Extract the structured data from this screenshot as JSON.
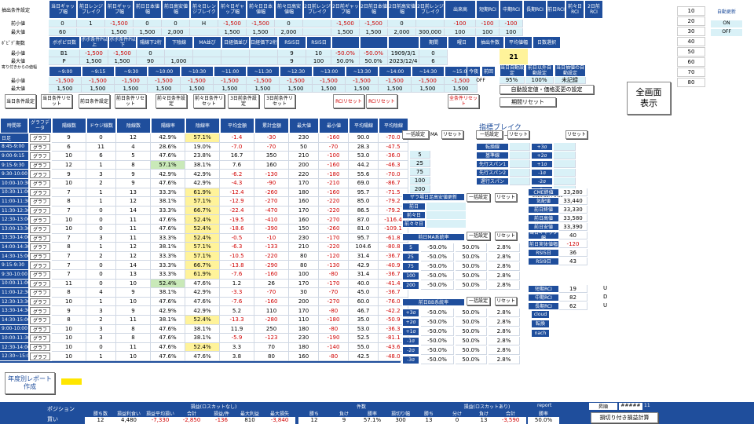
{
  "top": {
    "row_labels": [
      "抽出条件設定",
      "前小値",
      "最大値",
      "ﾎﾟﾋﾟﾃﾞ期数",
      "最小値",
      "最大値",
      "寄り付きからの値幅",
      "最小値",
      "最大値"
    ],
    "headers1": [
      "当日ギャップ幅",
      "前日レンジブレイク",
      "前日ギャップ幅",
      "前日日本値幅",
      "前日高安値幅",
      "前々日レンジブレイク",
      "前々日ギャップ幅",
      "前々日日本値幅",
      "前々日高安値幅",
      "2日前レンジブレイク",
      "2日前ギャップ幅",
      "2日前日本値幅",
      "2日前高安値幅",
      "2日前レンジブレイク",
      "出来高",
      "短期RCI",
      "中期RCI",
      "長期RCI",
      "前日RCI",
      "前々日RCI",
      "2日前RCI"
    ],
    "min1": [
      "0",
      "1",
      "-1,500",
      "0",
      "0",
      "H",
      "-1,500",
      "-1,500",
      "0",
      "",
      "-1,500",
      "-1,500",
      "0",
      "",
      "-100",
      "-100",
      "-100"
    ],
    "max1": [
      "60",
      "",
      "1,500",
      "1,500",
      "2,000",
      "",
      "1,500",
      "1,500",
      "2,000",
      "",
      "1,500",
      "1,500",
      "2,000",
      "300,000",
      "100",
      "100",
      "100"
    ],
    "headers2": [
      "ボポピ日数",
      "ボポ条件P以上",
      "ボポ条件P以下",
      "陽線下2桁",
      "下陰線",
      "MA並び",
      "日経価並び",
      "日経価下2桁",
      "RSI5日",
      "RSI5日",
      "",
      "",
      "",
      "期間",
      "曜日",
      "抽出件数",
      "平均値幅",
      "日数選択"
    ],
    "min2": [
      "B1",
      "-1,500",
      "-1,500",
      "0",
      "",
      "",
      "",
      "",
      "9",
      "10",
      "-50.0%",
      "-50.0%",
      "1909/3/1",
      "0"
    ],
    "max2": [
      "P",
      "1,500",
      "1,500",
      "90",
      "1,000",
      "",
      "",
      "",
      "9",
      "100",
      "50.0%",
      "50.0%",
      "2023/12/4",
      "6"
    ],
    "extract_count": "21",
    "time_headers": [
      "~9:00",
      "~9:15",
      "~9:30",
      "~10:00",
      "~10:30",
      "~11:00",
      "~11:30",
      "~12:30",
      "~13:00",
      "~13:30",
      "~14:00",
      "~14:30",
      "~15:00"
    ],
    "tmin": [
      "-1,500",
      "-1,500",
      "-1,500",
      "-1,500",
      "-1,500",
      "-1,500",
      "-1,500",
      "-1,500",
      "-1,500",
      "-1,500",
      "-1,500",
      "-1,500",
      "-1,500"
    ],
    "tmax": [
      "1,500",
      "1,500",
      "1,500",
      "1,500",
      "1,500",
      "1,500",
      "1,500",
      "1,500",
      "1,500",
      "1,500",
      "1,500",
      "1,500",
      "1,500"
    ],
    "right_small": [
      "今夜",
      "前回",
      "OFF"
    ],
    "auto_labels": [
      "当日自動設定",
      "前日以外自動設定",
      "当日抽値の自動設定"
    ],
    "auto_vals": [
      "95%",
      "100%",
      "未記録"
    ],
    "side_vals": [
      "10",
      "20",
      "30",
      "40",
      "50",
      "60",
      "70",
      "80"
    ],
    "auto_update": "自動更新",
    "on": "ON",
    "off": "OFF"
  },
  "buttons": {
    "row1": [
      "当日条件設定",
      "当日条件リセット",
      "前日条件設定",
      "前日条件リセット",
      "前々日条件設定",
      "前々日条件リセット",
      "3日前条件設定",
      "3日前条件リセット",
      "RCIリセット",
      "RCIリセット",
      "全条件リセット"
    ],
    "auto_set": "自動設定値・価格変更の設定",
    "period_reset": "期間リセット",
    "fullscreen": "全画面表示"
  },
  "table": {
    "headers": [
      "時間帯",
      "グラフデータ",
      "陽線数",
      "ドウジ線数",
      "陰線数",
      "陽線率",
      "陰線率",
      "平均金額",
      "累計金額",
      "最大値",
      "最小値",
      "平均陽線",
      "平均陰線"
    ],
    "graph_label": "グラフ",
    "rows": [
      [
        "日足",
        "9",
        "0",
        "12",
        "42.9%",
        "57.1%",
        "-1.4",
        "-30",
        "230",
        "-160",
        "90.0",
        "-70.0"
      ],
      [
        "8:45-9:00",
        "6",
        "11",
        "4",
        "28.6%",
        "19.0%",
        "-7.0",
        "-70",
        "50",
        "-70",
        "28.3",
        "-47.5"
      ],
      [
        "9:00-9:15",
        "10",
        "6",
        "5",
        "47.6%",
        "23.8%",
        "16.7",
        "350",
        "210",
        "-100",
        "53.0",
        "-36.0"
      ],
      [
        "9:15-9:30",
        "12",
        "1",
        "8",
        "57.1%",
        "38.1%",
        "7.6",
        "160",
        "200",
        "-160",
        "44.2",
        "-46.3"
      ],
      [
        "9:30-10:00",
        "9",
        "3",
        "9",
        "42.9%",
        "42.9%",
        "-6.2",
        "-130",
        "220",
        "-180",
        "55.6",
        "-70.0"
      ],
      [
        "10:00-10:30",
        "10",
        "2",
        "9",
        "47.6%",
        "42.9%",
        "-4.3",
        "-90",
        "170",
        "-210",
        "69.0",
        "-86.7"
      ],
      [
        "10:30-11:00",
        "7",
        "1",
        "13",
        "33.3%",
        "61.9%",
        "-12.4",
        "-260",
        "180",
        "-160",
        "95.7",
        "-71.5"
      ],
      [
        "11:00-11:30",
        "8",
        "1",
        "12",
        "38.1%",
        "57.1%",
        "-12.9",
        "-270",
        "160",
        "-220",
        "85.0",
        "-79.2"
      ],
      [
        "11:30-12:30",
        "7",
        "0",
        "14",
        "33.3%",
        "66.7%",
        "-22.4",
        "-470",
        "170",
        "-220",
        "86.5",
        "-79.2"
      ],
      [
        "12:30-13:00",
        "10",
        "0",
        "11",
        "47.6%",
        "52.4%",
        "-19.5",
        "-410",
        "160",
        "-270",
        "87.0",
        "-116.4"
      ],
      [
        "13:00-13:30",
        "10",
        "0",
        "11",
        "47.6%",
        "52.4%",
        "-18.6",
        "-390",
        "150",
        "-260",
        "81.0",
        "-109.1"
      ],
      [
        "13:30-14:00",
        "7",
        "3",
        "11",
        "33.3%",
        "52.4%",
        "-0.5",
        "-10",
        "230",
        "-170",
        "95.7",
        "-61.8"
      ],
      [
        "14:00-14:30",
        "8",
        "1",
        "12",
        "38.1%",
        "57.1%",
        "-6.3",
        "-133",
        "210",
        "-220",
        "104.6",
        "-80.8"
      ],
      [
        "14:30-15:00",
        "7",
        "2",
        "12",
        "33.3%",
        "57.1%",
        "-10.5",
        "-220",
        "80",
        "-120",
        "31.4",
        "-36.7"
      ],
      [
        "9:15-9:30",
        "7",
        "0",
        "14",
        "33.3%",
        "66.7%",
        "-13.8",
        "-290",
        "80",
        "-130",
        "42.9",
        "-40.9"
      ],
      [
        "9:30-10:00",
        "7",
        "0",
        "13",
        "33.3%",
        "61.9%",
        "-7.6",
        "-160",
        "100",
        "-80",
        "31.4",
        "-36.7"
      ],
      [
        "10:00-11:00",
        "11",
        "0",
        "10",
        "52.4%",
        "47.6%",
        "1.2",
        "26",
        "170",
        "-170",
        "40.0",
        "-41.4"
      ],
      [
        "11:00-12:30",
        "8",
        "4",
        "9",
        "38.1%",
        "42.9%",
        "-3.3",
        "-70",
        "30",
        "-70",
        "45.0",
        "-36.7"
      ],
      [
        "12:30-13:30",
        "10",
        "1",
        "10",
        "47.6%",
        "47.6%",
        "-7.6",
        "-160",
        "200",
        "-270",
        "60.0",
        "-76.0"
      ],
      [
        "13:30-14:30",
        "9",
        "3",
        "9",
        "42.9%",
        "42.9%",
        "5.2",
        "110",
        "170",
        "-80",
        "46.7",
        "-42.2"
      ],
      [
        "14:30-15:00",
        "8",
        "2",
        "11",
        "38.1%",
        "52.4%",
        "-13.3",
        "-280",
        "110",
        "-180",
        "35.0",
        "-50.9"
      ],
      [
        "9:00-10:00",
        "10",
        "3",
        "8",
        "47.6%",
        "38.1%",
        "11.9",
        "250",
        "180",
        "-80",
        "53.0",
        "-36.3"
      ],
      [
        "10:00-11:30",
        "10",
        "3",
        "8",
        "47.6%",
        "38.1%",
        "-5.9",
        "-123",
        "230",
        "-190",
        "52.5",
        "-81.1"
      ],
      [
        "12:30-14:00",
        "10",
        "0",
        "11",
        "47.6%",
        "52.4%",
        "3.3",
        "70",
        "180",
        "-140",
        "55.0",
        "-43.6"
      ],
      [
        "12:30~15:00",
        "10",
        "1",
        "10",
        "47.6%",
        "47.6%",
        "3.8",
        "80",
        "160",
        "-80",
        "42.5",
        "-48.0"
      ]
    ]
  },
  "indicator": {
    "title": "指標ブレイク",
    "bulk_set": "一括設定",
    "reset": "リセット",
    "ma_label": "MA",
    "one_day": "一日",
    "ma_vals": [
      "5",
      "25",
      "75",
      "100",
      "200"
    ],
    "right_labels": [
      "転換線",
      "基準線",
      "先行スパン1",
      "先行スパン2",
      "遅行スパン"
    ],
    "sigma_labels": [
      "+3σ",
      "+2σ",
      "+1σ",
      "-1σ",
      "-2σ",
      "-3σ"
    ],
    "gap_title": "ザラ場日足高安値更新",
    "day_labels": [
      "前日",
      "前々日",
      "前々々日"
    ],
    "datetime": "2023/12/4 8:36",
    "stats": [
      [
        "CME終値",
        "33,280"
      ],
      [
        "気配値",
        "33,440"
      ],
      [
        "前日終値",
        "33,330"
      ],
      [
        "前日高値",
        "33,580"
      ],
      [
        "前日安値",
        "33,390"
      ],
      [
        "当日ギャップ幅",
        "40"
      ],
      [
        "前日実体値幅",
        "-120"
      ],
      [
        "RSI5日",
        "36"
      ],
      [
        "RSI9日",
        "43"
      ]
    ],
    "ma_title": "前日MA系統率",
    "ma_rows": [
      [
        "5",
        "-50.0%",
        "50.0%",
        "2.8%"
      ],
      [
        "25",
        "-50.0%",
        "50.0%",
        "2.8%"
      ],
      [
        "75",
        "-50.0%",
        "50.0%",
        "2.8%"
      ],
      [
        "100",
        "-50.0%",
        "50.0%",
        "2.8%"
      ],
      [
        "200",
        "-50.0%",
        "50.0%",
        "2.8%"
      ]
    ],
    "rci": [
      [
        "短期RCI",
        "19",
        "U"
      ],
      [
        "中期RCI",
        "82",
        "D"
      ],
      [
        "長期RCI",
        "62",
        "U"
      ]
    ],
    "bb_title": "前日BB系統率",
    "bb_rows": [
      [
        "+3σ",
        "-50.0%",
        "50.0%",
        "2.8%"
      ],
      [
        "+2σ",
        "-50.0%",
        "50.0%",
        "2.8%"
      ],
      [
        "+1σ",
        "-50.0%",
        "50.0%",
        "2.8%"
      ],
      [
        "-1σ",
        "-50.0%",
        "50.0%",
        "2.8%"
      ],
      [
        "-2σ",
        "-50.0%",
        "50.0%",
        "2.8%"
      ],
      [
        "-3σ",
        "-50.0%",
        "50.0%",
        "2.8%"
      ]
    ],
    "cloud_labels": [
      "cloud",
      "転換",
      "nach"
    ]
  },
  "bottom": {
    "yearly_report": "年度別レポート作成",
    "position": "ポジション",
    "buy": "買い",
    "group1": "損益(ロスカットなし)",
    "group2": "件数",
    "group3": "損益(ロスカットあり)",
    "report_label": "report",
    "sort_label": "昇順",
    "sort_time": "#####",
    "sort_num": "11",
    "headers": [
      "勝ち数",
      "損益利食い",
      "損益平均損い",
      "合計",
      "損益/件",
      "最大利益",
      "最大損失",
      "勝ち",
      "負け",
      "勝率",
      "損切り幅",
      "勝ち",
      "分け",
      "負け",
      "合計",
      "勝率"
    ],
    "values": [
      "12",
      "4,480",
      "-7,330",
      "-2,850",
      "-136",
      "810",
      "-3,840",
      "12",
      "9",
      "57.1%",
      "300",
      "13",
      "0",
      "13",
      "-3,590",
      "50.0%"
    ],
    "calc_button": "損切り付き損益計算"
  }
}
